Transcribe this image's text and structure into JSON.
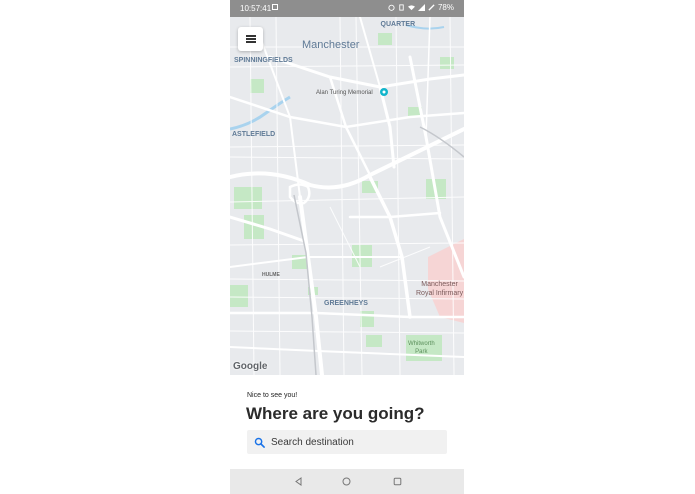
{
  "status_bar": {
    "time": "10:57:41",
    "battery": "78%",
    "icons": [
      "image-icon",
      "alarm-icon",
      "vibrate-icon",
      "wifi-icon",
      "cellular-icon",
      "battery-icon"
    ]
  },
  "map": {
    "labels": {
      "northern_quarter": "NORTHERN\nQUARTER",
      "manchester": "Manchester",
      "spinningfields": "SPINNINGFIELDS",
      "castlefield": "ASTLEFIELD",
      "alan_turing": "Alan Turing Memorial",
      "hulme": "HULME",
      "greenheys": "GREENHEYS",
      "royal_infirmary": "Manchester\nRoyal Infirmary",
      "whitworth": "Whitworth\nPark"
    },
    "attribution": "Google",
    "menu_icon": "hamburger-menu-icon"
  },
  "sheet": {
    "greeting": "Nice to see you!",
    "headline": "Where are you going?",
    "search_placeholder": "Search destination",
    "search_icon": "search-icon"
  },
  "nav_bar": {
    "buttons": [
      "back-icon",
      "home-icon",
      "recents-icon"
    ]
  },
  "colors": {
    "status_bar": "#8e8e8e",
    "map_background": "#e8eaed",
    "park": "#c5e8c5",
    "hospital": "#f6d5d5",
    "road": "#ffffff",
    "search_field": "#f1f1f1",
    "accent": "#1a73e8"
  }
}
